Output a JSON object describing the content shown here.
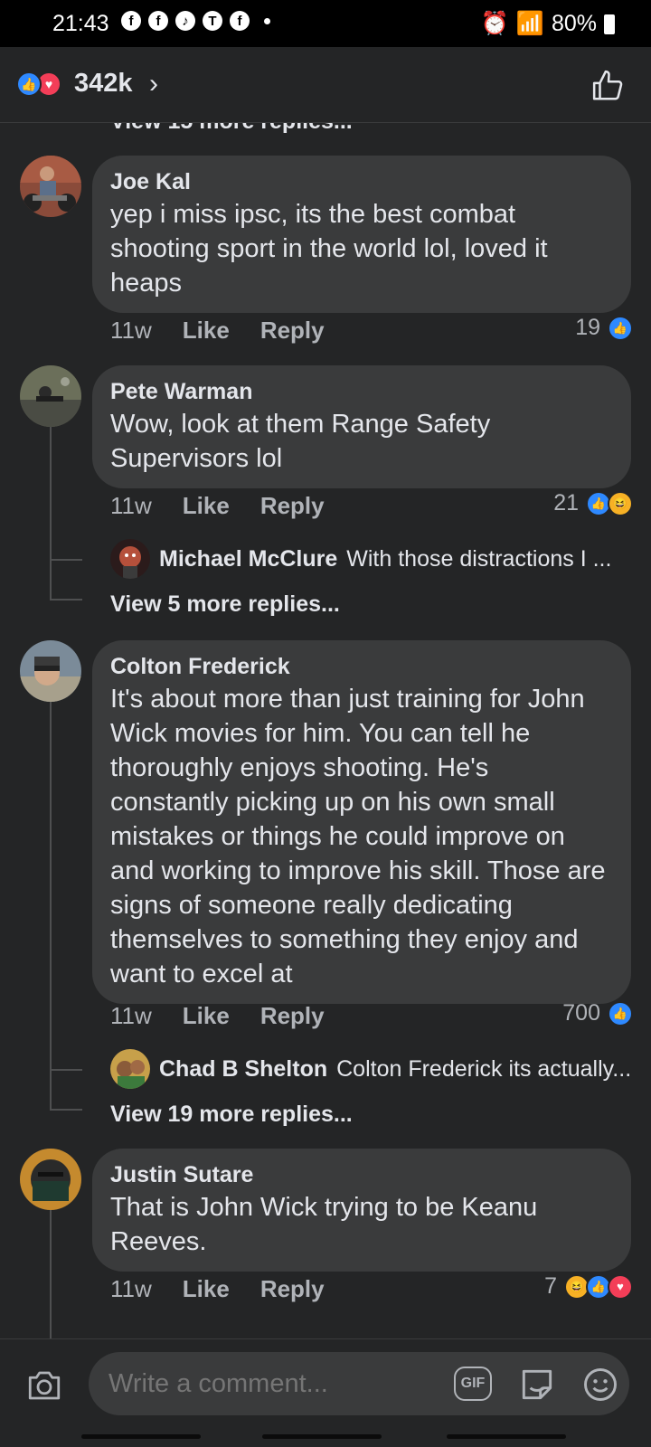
{
  "status": {
    "time": "21:43",
    "battery": "80%"
  },
  "header": {
    "reaction_count": "342k"
  },
  "feed": {
    "cutoff_text": "View 15 more replies..."
  },
  "comments": [
    {
      "name": "Joe Kal",
      "text": "yep i miss ipsc, its the best combat shooting sport in the world lol, loved it heaps",
      "time": "11w",
      "like": "Like",
      "reply": "Reply",
      "count": "19"
    },
    {
      "name": "Pete Warman",
      "text": "Wow, look at them Range Safety Supervisors lol",
      "time": "11w",
      "like": "Like",
      "reply": "Reply",
      "count": "21",
      "reply_preview": {
        "name": "Michael McClure",
        "text": "With those distractions I ..."
      },
      "view_more": "View 5 more replies..."
    },
    {
      "name": "Colton Frederick",
      "text": "It's about more than just training for John Wick movies for him. You can tell he thoroughly enjoys shooting. He's constantly picking up on his own small mistakes or things he could improve on and working to improve his skill. Those are signs of someone really dedicating themselves to something they enjoy and want to excel at",
      "time": "11w",
      "like": "Like",
      "reply": "Reply",
      "count": "700",
      "reply_preview": {
        "name": "Chad B Shelton",
        "text": "Colton Frederick its actually..."
      },
      "view_more": "View 19 more replies..."
    },
    {
      "name": "Justin Sutare",
      "text": "That is John Wick trying to be Keanu Reeves.",
      "time": "11w",
      "like": "Like",
      "reply": "Reply",
      "count": "7"
    }
  ],
  "composer": {
    "placeholder": "Write a comment...",
    "gif_label": "GIF"
  },
  "colors": {
    "background": "#242526",
    "bubble": "#3a3b3c",
    "like": "#2e89ff",
    "love": "#f33e58",
    "haha": "#f7b125"
  },
  "icons": [
    "like-icon",
    "love-icon",
    "haha-icon",
    "camera-icon",
    "gif-icon",
    "sticker-icon",
    "emoji-icon",
    "thumbs-up-outline-icon",
    "chevron-right-icon"
  ]
}
